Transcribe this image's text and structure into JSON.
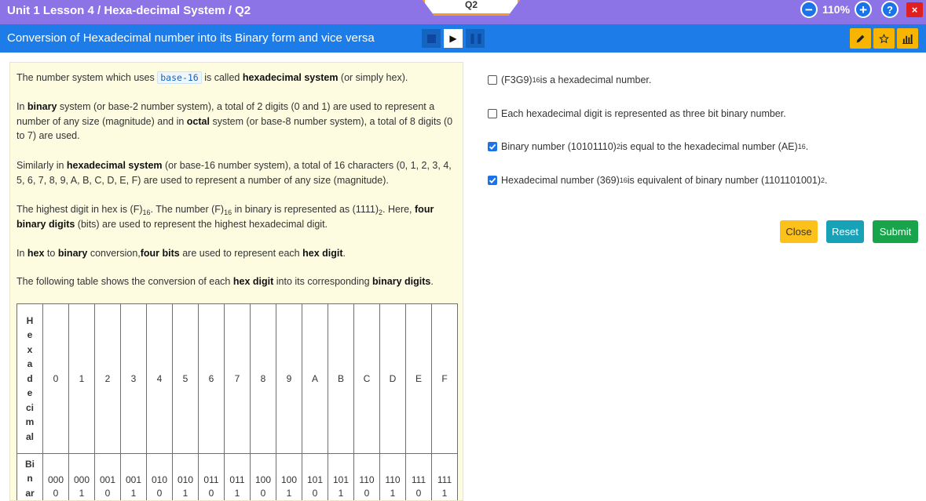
{
  "header": {
    "breadcrumb": "Unit 1 Lesson 4 / Hexa-decimal System / Q2",
    "question_tab": "Q2",
    "zoom_minus": "−",
    "zoom_level": "110%",
    "zoom_plus": "+",
    "help": "?",
    "close": "×"
  },
  "titlebar": {
    "title": "Conversion of Hexadecimal number into its Binary form and vice versa",
    "play": "▶",
    "pause": "❚❚",
    "tool_icons": [
      "pencil-icon",
      "star-icon",
      "bar-chart-icon"
    ]
  },
  "content": {
    "p1_a": "The number system which uses ",
    "p1_code": "base-16",
    "p1_b": " is called ",
    "p1_bold": "hexadecimal system",
    "p1_c": " (or simply hex).",
    "p2_a": "In ",
    "p2_bold1": "binary",
    "p2_b": " system (or base-2 number system), a total of 2 digits (0 and 1) are used to represent a number of any size (magnitude) and in ",
    "p2_bold2": "octal",
    "p2_c": " system (or base-8 number system), a total of 8 digits (0 to 7) are used.",
    "p3_a": "Similarly in ",
    "p3_bold": "hexadecimal system",
    "p3_b": " (or base-16 number system), a total of 16 characters (0, 1, 2, 3, 4, 5, 6, 7, 8, 9, A, B, C, D, E, F) are used to represent a number of any size (magnitude).",
    "p4_a": "The highest digit in hex is (F)",
    "p4_s1": "16",
    "p4_b": ". The number (F)",
    "p4_s2": "16",
    "p4_c": " in binary is represented as (1111)",
    "p4_s3": "2",
    "p4_d": ". Here, ",
    "p4_bold": "four binary digits",
    "p4_e": " (bits) are used to represent the highest hexadecimal digit.",
    "p5_a": "In ",
    "p5_bold1": "hex",
    "p5_b": " to ",
    "p5_bold2": "binary",
    "p5_c": " conversion,",
    "p5_bold3": "four bits",
    "p5_d": " are used to represent each ",
    "p5_bold4": "hex digit",
    "p5_e": ".",
    "p6_a": "The following table shows the conversion of each ",
    "p6_bold1": "hex digit",
    "p6_b": " into its corresponding ",
    "p6_bold2": "binary digits",
    "p6_c": "."
  },
  "table": {
    "hex_header": [
      "H",
      "e",
      "x",
      "a",
      "d",
      "e",
      "ci",
      "m",
      "al"
    ],
    "bin_header": [
      "Bi",
      "n",
      "ar"
    ],
    "hex_digits": [
      "0",
      "1",
      "2",
      "3",
      "4",
      "5",
      "6",
      "7",
      "8",
      "9",
      "A",
      "B",
      "C",
      "D",
      "E",
      "F"
    ],
    "bin_top": [
      "000",
      "000",
      "001",
      "001",
      "010",
      "010",
      "011",
      "011",
      "100",
      "100",
      "101",
      "101",
      "110",
      "110",
      "111",
      "111"
    ],
    "bin_bottom": [
      "0",
      "1",
      "0",
      "1",
      "0",
      "1",
      "0",
      "1",
      "0",
      "1",
      "0",
      "1",
      "0",
      "1",
      "0",
      "1"
    ]
  },
  "options": [
    {
      "checked": false,
      "t1": "(F3G9)",
      "s1": "16",
      "t2": " is a hexadecimal number.",
      "s2": "",
      "t3": ""
    },
    {
      "checked": false,
      "t1": "Each hexadecimal digit is represented as three bit binary number.",
      "s1": "",
      "t2": "",
      "s2": "",
      "t3": ""
    },
    {
      "checked": true,
      "t1": "Binary number (10101110)",
      "s1": "2",
      "t2": " is equal to the hexadecimal number (AE)",
      "s2": "16",
      "t3": "."
    },
    {
      "checked": true,
      "t1": "Hexadecimal number (369)",
      "s1": "16",
      "t2": " is equivalent of binary number (1101101001)",
      "s2": "2",
      "t3": "."
    }
  ],
  "actions": {
    "close": "Close",
    "reset": "Reset",
    "submit": "Submit"
  },
  "colors": {
    "topbar": "#8d74e6",
    "titlebar": "#1e7ce8",
    "accent_orange": "#f29a2e",
    "close_btn": "#fcc21b",
    "reset_btn": "#17a2b8",
    "submit_btn": "#17a44b"
  }
}
